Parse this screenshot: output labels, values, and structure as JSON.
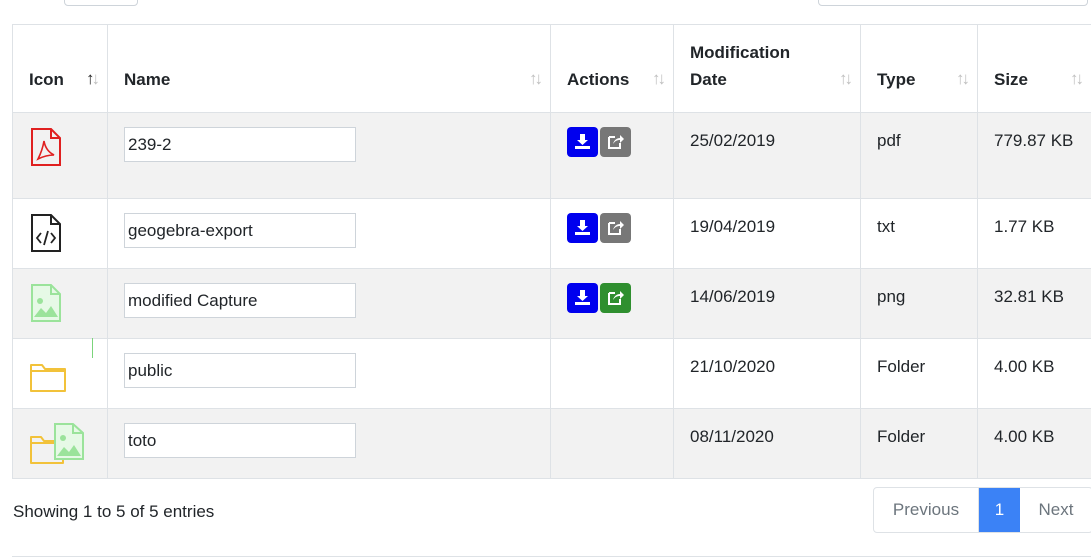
{
  "table": {
    "columns": [
      {
        "label": "Icon",
        "sorted": "asc"
      },
      {
        "label": "Name"
      },
      {
        "label": "Actions"
      },
      {
        "label": "Modification Date"
      },
      {
        "label": "Type"
      },
      {
        "label": "Size"
      }
    ],
    "rows": [
      {
        "icon": "pdf-file-icon",
        "name": "239-2",
        "actions": [
          "download",
          "share"
        ],
        "share_color": "#777777",
        "date": "25/02/2019",
        "type": "pdf",
        "size": "779.87 KB"
      },
      {
        "icon": "code-file-icon",
        "name": "geogebra-export",
        "actions": [
          "download",
          "share"
        ],
        "share_color": "#777777",
        "date": "19/04/2019",
        "type": "txt",
        "size": "1.77 KB"
      },
      {
        "icon": "image-file-icon",
        "name": "modified Capture",
        "actions": [
          "download",
          "share"
        ],
        "share_color": "#2f8f2f",
        "date": "14/06/2019",
        "type": "png",
        "size": "32.81 KB"
      },
      {
        "icon": "folder-icon",
        "name": "public",
        "actions": [],
        "date": "21/10/2020",
        "type": "Folder",
        "size": "4.00 KB"
      },
      {
        "icon": "folder-image-icon",
        "name": "toto",
        "actions": [],
        "date": "08/11/2020",
        "type": "Folder",
        "size": "4.00 KB"
      }
    ]
  },
  "footer": {
    "info": "Showing 1 to 5 of 5 entries"
  },
  "pagination": {
    "previous": "Previous",
    "current": "1",
    "next": "Next"
  },
  "colors": {
    "download_button": "#0000ee",
    "page_active": "#3b82f6",
    "pdf_icon": "#e02020",
    "folder_icon": "#f2c23a",
    "image_icon": "#9be39b"
  }
}
